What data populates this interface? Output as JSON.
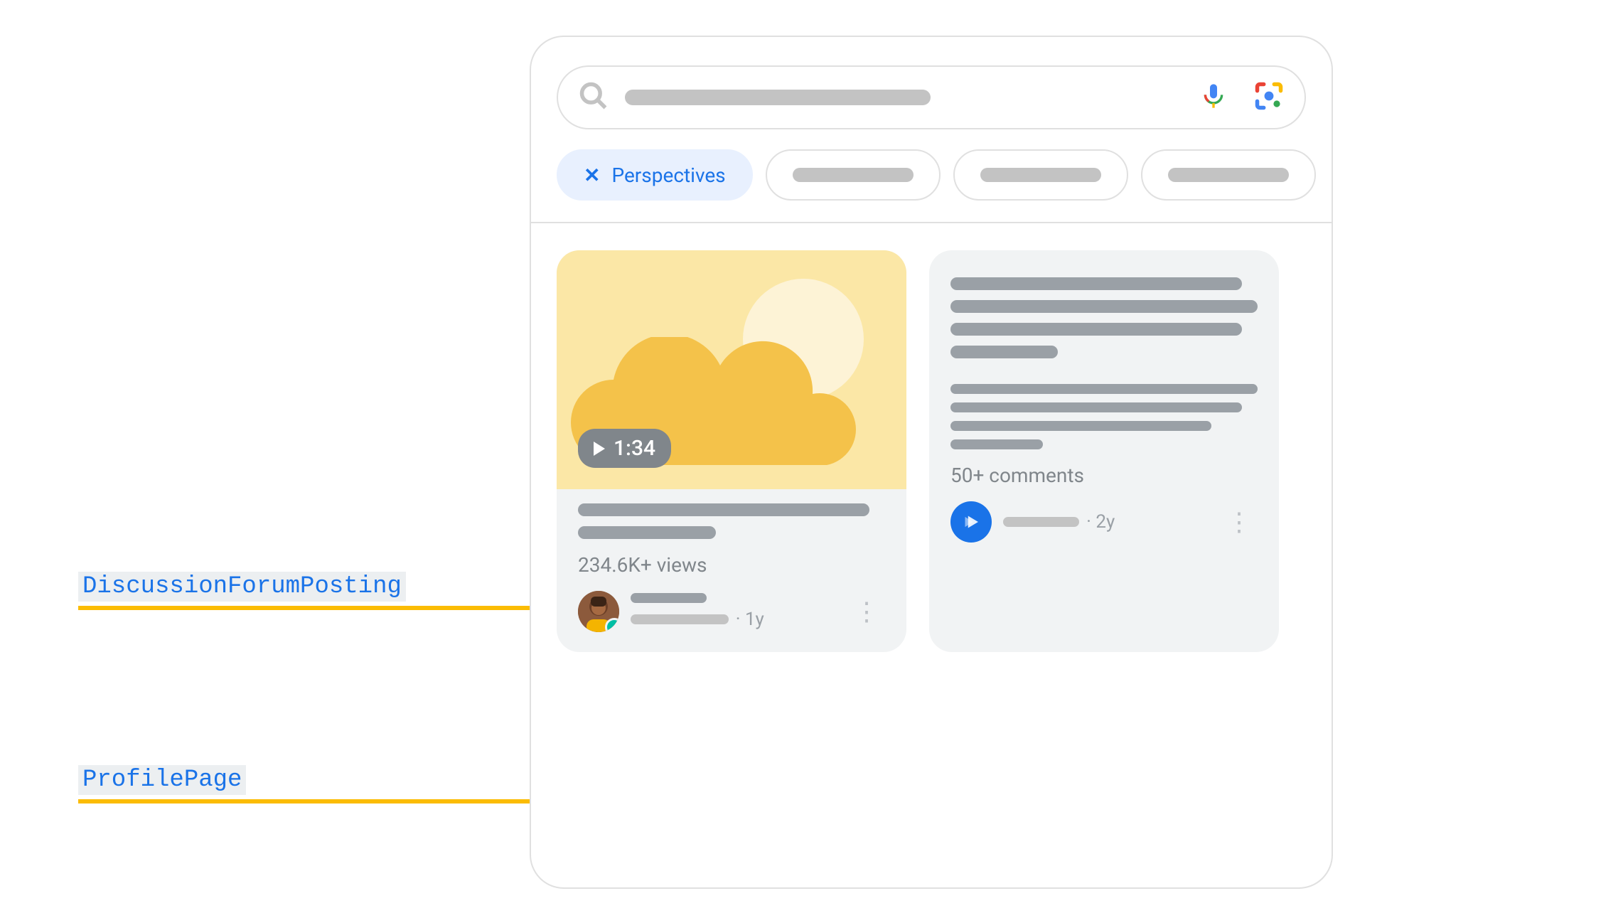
{
  "annotations": {
    "discussion": "DiscussionForumPosting",
    "profile": "ProfilePage"
  },
  "chips": {
    "active_label": "Perspectives"
  },
  "video_card": {
    "duration": "1:34",
    "views": "234.6K+ views",
    "age": "1y"
  },
  "text_card": {
    "comments": "50+ comments",
    "age": "2y"
  }
}
